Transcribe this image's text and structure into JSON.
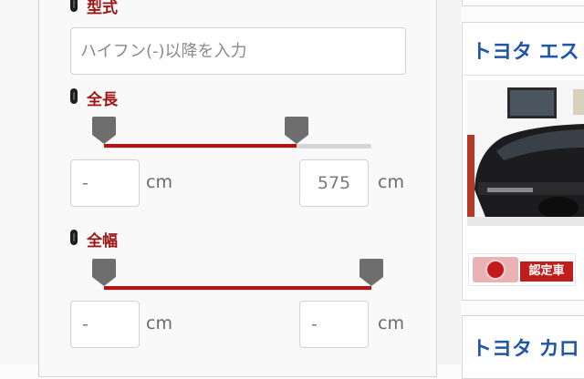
{
  "filters": {
    "model": {
      "label": "型式",
      "placeholder": "ハイフン(-)以降を入力"
    },
    "length": {
      "label": "全長",
      "min_value": "-",
      "max_value": "575",
      "unit": "cm",
      "slider_min_fraction": 0.0,
      "slider_max_fraction": 0.72
    },
    "width": {
      "label": "全幅",
      "min_value": "-",
      "max_value": "-",
      "unit": "cm",
      "slider_min_fraction": 0.0,
      "slider_max_fraction": 1.0
    }
  },
  "sidebar": {
    "cards": [
      {
        "title": "トヨタ エス",
        "badge_label": "認定車",
        "has_photo": true
      },
      {
        "title": "トヨタ カロ"
      }
    ]
  },
  "colors": {
    "label_red": "#9c1616",
    "slider_red": "#b01414",
    "link_blue": "#2256a7",
    "handle_gray": "#6e6e6e"
  },
  "icons": {
    "label_bullet": "pill-bullet-icon",
    "slider_handle": "slider-handle-icon",
    "certified_seal": "certified-seal-icon"
  }
}
